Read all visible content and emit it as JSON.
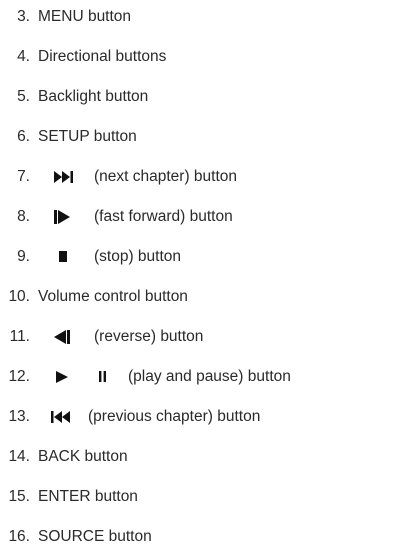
{
  "items": [
    {
      "num": "3.",
      "label": "MENU button"
    },
    {
      "num": "4.",
      "label": "Directional buttons"
    },
    {
      "num": "5.",
      "label": "Backlight button"
    },
    {
      "num": "6.",
      "label": "SETUP button"
    },
    {
      "num": "7.",
      "icon": "next-chapter-icon",
      "label": "(next chapter) button"
    },
    {
      "num": "8.",
      "icon": "fast-forward-icon",
      "label": "(fast forward) button"
    },
    {
      "num": "9.",
      "icon": "stop-icon",
      "label": "(stop) button"
    },
    {
      "num": "10.",
      "label": "Volume control button"
    },
    {
      "num": "11.",
      "icon": "reverse-icon",
      "label": "(reverse) button"
    },
    {
      "num": "12.",
      "icon": "play-icon",
      "icon2": "pause-icon",
      "label": "(play and pause) button"
    },
    {
      "num": "13.",
      "icon": "previous-chapter-icon",
      "label": "(previous chapter) button"
    },
    {
      "num": "14.",
      "label": "BACK button"
    },
    {
      "num": "15.",
      "label": "ENTER button"
    },
    {
      "num": "16.",
      "label": "SOURCE button"
    }
  ]
}
